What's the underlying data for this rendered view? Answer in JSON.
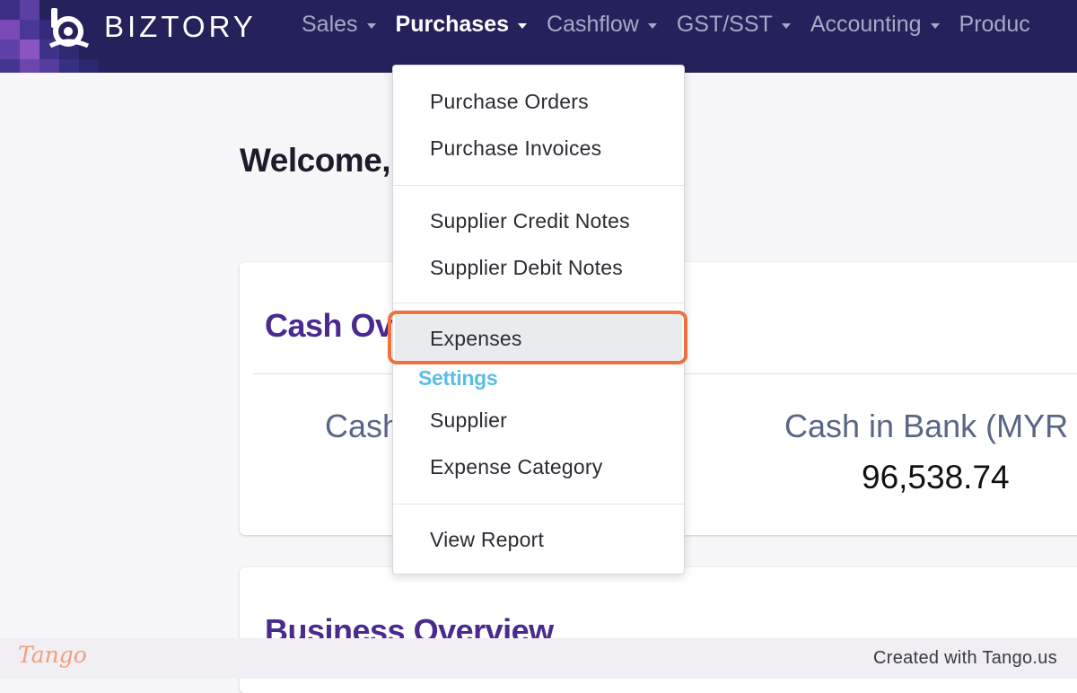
{
  "brand": {
    "name": "BIZTORY"
  },
  "nav": {
    "items": [
      {
        "label": "Sales"
      },
      {
        "label": "Purchases",
        "active": true
      },
      {
        "label": "Cashflow"
      },
      {
        "label": "GST/SST"
      },
      {
        "label": "Accounting"
      },
      {
        "label": "Produc"
      }
    ]
  },
  "page": {
    "welcome": "Welcome,",
    "cash_overview_title": "Cash Ov",
    "cash_label": "Cash",
    "cash_in_bank_label": "Cash in Bank (MYR",
    "cash_in_bank_value": "96,538.74",
    "business_overview_title": "Business Overview"
  },
  "dropdown": {
    "purchase_orders": "Purchase Orders",
    "purchase_invoices": "Purchase Invoices",
    "supplier_credit_notes": "Supplier Credit Notes",
    "supplier_debit_notes": "Supplier Debit Notes",
    "expenses": "Expenses",
    "settings_heading": "Settings",
    "supplier": "Supplier",
    "expense_category": "Expense Category",
    "view_report": "View Report"
  },
  "footer": {
    "logo": "Tango",
    "credit": "Created with Tango.us"
  },
  "colors": {
    "nav_bg": "#25215a",
    "highlight_ring": "#f0703e",
    "settings_heading": "#5bbde6",
    "card_title": "#4a2a8f"
  }
}
